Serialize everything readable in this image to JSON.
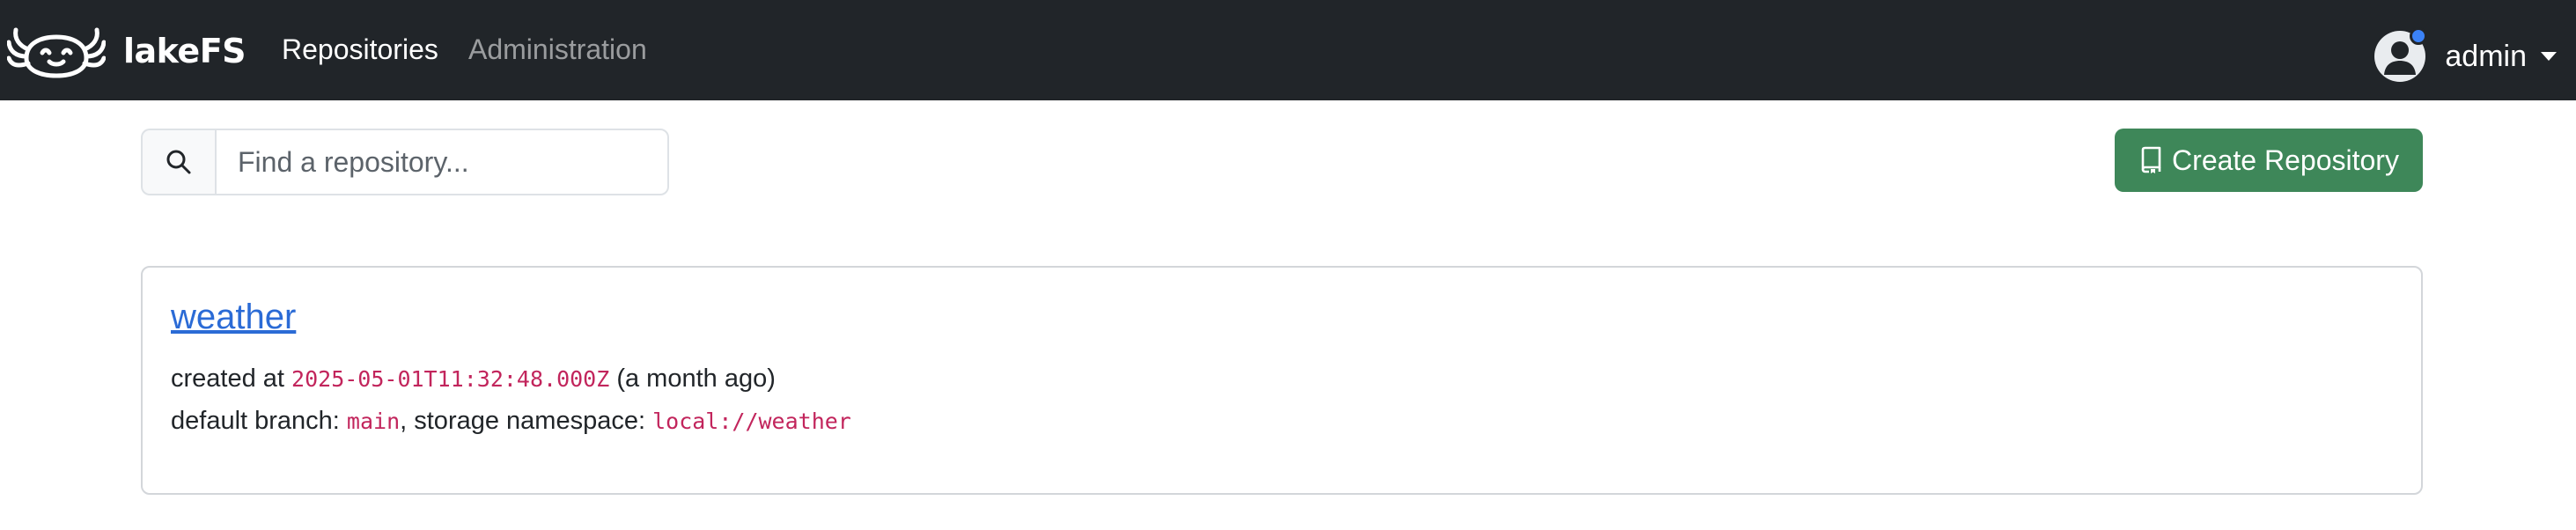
{
  "navbar": {
    "brand": "lakeFS",
    "links": [
      {
        "label": "Repositories",
        "active": true
      },
      {
        "label": "Administration",
        "active": false
      }
    ],
    "user": {
      "name": "admin",
      "notification_color": "#3b82f6"
    }
  },
  "search": {
    "placeholder": "Find a repository...",
    "value": "",
    "icon": "search-icon"
  },
  "create_button": {
    "label": "Create Repository",
    "icon": "repo-icon",
    "color": "#3e8759"
  },
  "repositories": [
    {
      "name": "weather",
      "created_label": "created at",
      "created_at": "2025-05-01T11:32:48.000Z",
      "created_relative": "(a month ago)",
      "default_branch_label": "default branch:",
      "default_branch": "main",
      "storage_label": ", storage namespace:",
      "storage_namespace": "local://weather"
    }
  ],
  "colors": {
    "navbar_bg": "#212529",
    "link": "#2b6bd6",
    "code": "#c2255c"
  }
}
